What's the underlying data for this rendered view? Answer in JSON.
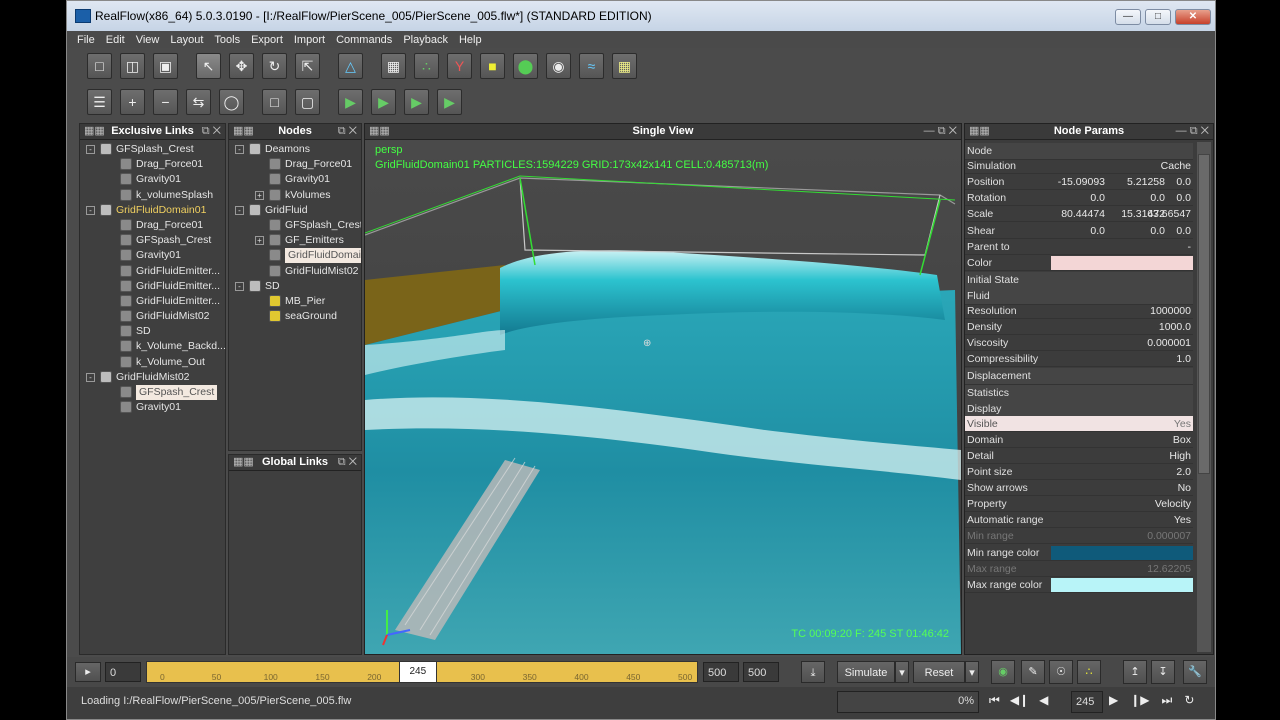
{
  "title_bar": {
    "text": "RealFlow(x86_64) 5.0.3.0190 - [I:/RealFlow/PierScene_005/PierScene_005.flw*] (STANDARD EDITION)"
  },
  "menu": [
    "File",
    "Edit",
    "View",
    "Layout",
    "Tools",
    "Export",
    "Import",
    "Commands",
    "Playback",
    "Help"
  ],
  "panels": {
    "exclusive_links": "Exclusive Links",
    "nodes": "Nodes",
    "global_links": "Global Links",
    "single_view": "Single View",
    "node_params": "Node Params"
  },
  "exclusive_tree": [
    {
      "label": "GFSplash_Crest",
      "indent": 0,
      "exp": "-"
    },
    {
      "label": "Drag_Force01",
      "indent": 1
    },
    {
      "label": "Gravity01",
      "indent": 1
    },
    {
      "label": "k_volumeSplash",
      "indent": 1
    },
    {
      "label": "GridFluidDomain01",
      "indent": 0,
      "exp": "-",
      "hl": true
    },
    {
      "label": "Drag_Force01",
      "indent": 1
    },
    {
      "label": "GFSpash_Crest",
      "indent": 1
    },
    {
      "label": "Gravity01",
      "indent": 1
    },
    {
      "label": "GridFluidEmitter...",
      "indent": 1
    },
    {
      "label": "GridFluidEmitter...",
      "indent": 1
    },
    {
      "label": "GridFluidEmitter...",
      "indent": 1
    },
    {
      "label": "GridFluidMist02",
      "indent": 1
    },
    {
      "label": "SD",
      "indent": 1
    },
    {
      "label": "k_Volume_Backd...",
      "indent": 1
    },
    {
      "label": "k_Volume_Out",
      "indent": 1
    },
    {
      "label": "GridFluidMist02",
      "indent": 0,
      "exp": "-"
    },
    {
      "label": "GFSpash_Crest",
      "indent": 1,
      "sel": true
    },
    {
      "label": "Gravity01",
      "indent": 1
    }
  ],
  "nodes_tree": [
    {
      "label": "Deamons",
      "indent": 0,
      "exp": "-"
    },
    {
      "label": "Drag_Force01",
      "indent": 1
    },
    {
      "label": "Gravity01",
      "indent": 1
    },
    {
      "label": "kVolumes",
      "indent": 1,
      "exp": "+"
    },
    {
      "label": "GridFluid",
      "indent": 0,
      "exp": "-"
    },
    {
      "label": "GFSplash_Crest",
      "indent": 1
    },
    {
      "label": "GF_Emitters",
      "indent": 1,
      "exp": "+"
    },
    {
      "label": "GridFluidDomain01",
      "indent": 1,
      "sel": true
    },
    {
      "label": "GridFluidMist02",
      "indent": 1
    },
    {
      "label": "SD",
      "indent": 0,
      "exp": "-"
    },
    {
      "label": "MB_Pier",
      "indent": 1,
      "icon": "y"
    },
    {
      "label": "seaGround",
      "indent": 1,
      "icon": "y"
    }
  ],
  "viewport": {
    "camera": "persp",
    "info": "GridFluidDomain01 PARTICLES:1594229 GRID:173x42x141 CELL:0.485713(m)",
    "hud": "TC 00:09:20   F: 245   ST 01:46:42"
  },
  "params": [
    {
      "type": "sec",
      "k": "Node"
    },
    {
      "type": "row",
      "k": "Simulation",
      "v3": "Cache"
    },
    {
      "type": "row",
      "k": "Position",
      "v1": "-15.09093",
      "v2": "5.21258",
      "v3": "0.0"
    },
    {
      "type": "row",
      "k": "Rotation",
      "v1": "0.0",
      "v2": "0.0",
      "v3": "0.0"
    },
    {
      "type": "row",
      "k": "Scale",
      "v1": "80.44474",
      "v2": "15.31472",
      "v3": "63.66547"
    },
    {
      "type": "row",
      "k": "Shear",
      "v1": "0.0",
      "v2": "0.0",
      "v3": "0.0"
    },
    {
      "type": "row",
      "k": "Parent to",
      "v3": "-"
    },
    {
      "type": "color",
      "k": "Color",
      "c": "#f3d6d6"
    },
    {
      "type": "sec",
      "k": "Initial State"
    },
    {
      "type": "sec",
      "k": "Fluid"
    },
    {
      "type": "row",
      "k": "Resolution",
      "v3": "1000000"
    },
    {
      "type": "row",
      "k": "Density",
      "v3": "1000.0"
    },
    {
      "type": "row",
      "k": "Viscosity",
      "v3": "0.000001"
    },
    {
      "type": "row",
      "k": "Compressibility",
      "v3": "1.0"
    },
    {
      "type": "sec",
      "k": "Displacement"
    },
    {
      "type": "sec",
      "k": "Statistics"
    },
    {
      "type": "sec",
      "k": "Display"
    },
    {
      "type": "row",
      "k": "Visible",
      "v3": "Yes",
      "sel": true
    },
    {
      "type": "row",
      "k": "Domain",
      "v3": "Box"
    },
    {
      "type": "row",
      "k": "Detail",
      "v3": "High"
    },
    {
      "type": "row",
      "k": "Point size",
      "v3": "2.0"
    },
    {
      "type": "row",
      "k": "Show arrows",
      "v3": "No"
    },
    {
      "type": "row",
      "k": "Property",
      "v3": "Velocity"
    },
    {
      "type": "row",
      "k": "Automatic range",
      "v3": "Yes"
    },
    {
      "type": "row",
      "k": "Min range",
      "v3": "0.000007",
      "dim": true
    },
    {
      "type": "color",
      "k": "Min range color",
      "c": "#0f5a7a"
    },
    {
      "type": "row",
      "k": "Max range",
      "v3": "12.62205",
      "dim": true
    },
    {
      "type": "color",
      "k": "Max range color",
      "c": "#b8f4f8"
    }
  ],
  "timeline": {
    "start_field": "0",
    "ticks": [
      "0",
      "50",
      "100",
      "150",
      "200",
      "250",
      "300",
      "350",
      "400",
      "450",
      "500"
    ],
    "current_frame": "245",
    "end_field_1": "500",
    "end_field_2": "500",
    "simulate": "Simulate",
    "reset": "Reset"
  },
  "status": {
    "message": "Loading I:/RealFlow/PierScene_005/PierScene_005.flw",
    "progress": "0%",
    "progress_value": 0,
    "frame": "245"
  }
}
